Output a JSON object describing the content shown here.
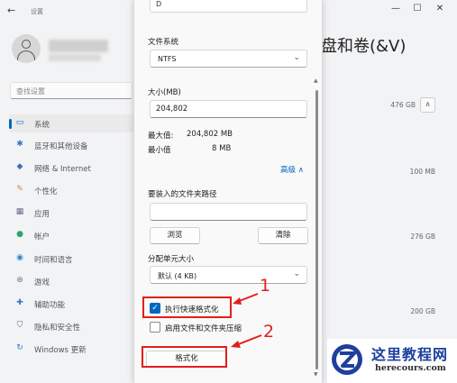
{
  "app": {
    "title": "设置"
  },
  "window_controls": {
    "minimize": "—",
    "maximize": "☐",
    "close": "✕"
  },
  "search": {
    "placeholder": "查找设置"
  },
  "sidebar": {
    "items": [
      {
        "label": "系统",
        "icon": "monitor-icon",
        "glyph": "▭",
        "color": "#0067c0",
        "active": true
      },
      {
        "label": "蓝牙和其他设备",
        "icon": "bluetooth-icon",
        "glyph": "✱",
        "color": "#3a78c3"
      },
      {
        "label": "网络 & Internet",
        "icon": "wifi-icon",
        "glyph": "◆",
        "color": "#3a6fb5"
      },
      {
        "label": "个性化",
        "icon": "brush-icon",
        "glyph": "✎",
        "color": "#c48a3a"
      },
      {
        "label": "应用",
        "icon": "apps-icon",
        "glyph": "▦",
        "color": "#6a6a8a"
      },
      {
        "label": "帐户",
        "icon": "account-icon",
        "glyph": "●",
        "color": "#2fa36b"
      },
      {
        "label": "时间和语言",
        "icon": "globe-clock-icon",
        "glyph": "◉",
        "color": "#2b86c9"
      },
      {
        "label": "游戏",
        "icon": "gamepad-icon",
        "glyph": "⊕",
        "color": "#7a7a7a"
      },
      {
        "label": "辅助功能",
        "icon": "accessibility-icon",
        "glyph": "✚",
        "color": "#3477c7"
      },
      {
        "label": "隐私和安全性",
        "icon": "shield-icon",
        "glyph": "⛉",
        "color": "#6b6b6b"
      },
      {
        "label": "Windows 更新",
        "icon": "update-icon",
        "glyph": "↻",
        "color": "#2b74c9"
      }
    ]
  },
  "main": {
    "title_fragment": "盘和卷(&V)",
    "sizes": [
      "476 GB",
      "100 MB",
      "276 GB",
      "200 GB"
    ]
  },
  "dialog": {
    "top_field_value": "D",
    "filesystem": {
      "label": "文件系统",
      "value": "NTFS"
    },
    "size": {
      "label": "大小(MB)",
      "value": "204,802"
    },
    "max": {
      "label": "最大值:",
      "value": "204,802 MB"
    },
    "min": {
      "label": "最小值",
      "value": "8 MB"
    },
    "advanced_label": "高级",
    "mount_path": {
      "label": "要装入的文件夹路径",
      "value": ""
    },
    "browse_label": "浏览",
    "clear_label": "清除",
    "cluster": {
      "label": "分配单元大小",
      "value": "默认 (4 KB)"
    },
    "quick_format": {
      "label": "执行快速格式化",
      "checked": true
    },
    "compression": {
      "label": "启用文件和文件夹压缩",
      "checked": false
    },
    "format_label": "格式化"
  },
  "annotations": {
    "one": "1",
    "two": "2",
    "color": "#e0201b"
  },
  "watermark": {
    "name": "这里教程网",
    "url": "herecours.com"
  }
}
